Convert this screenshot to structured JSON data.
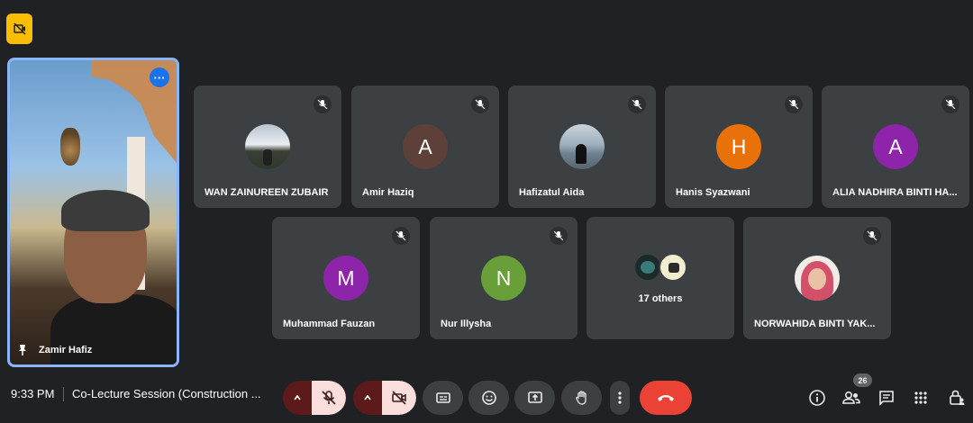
{
  "top_badge": {
    "icon": "no-video-badge-icon",
    "color": "#fbbc04"
  },
  "speaker": {
    "name": "Zamir Hafiz",
    "more_icon": "more-options-icon",
    "pin_icon": "pin-icon"
  },
  "tiles_row1": [
    {
      "name": "WAN ZAINUREEN ZUBAIR",
      "avatar_type": "photo",
      "avatar_letter": "",
      "avatar_color": "#6d7b8a"
    },
    {
      "name": "Amir Haziq",
      "avatar_type": "letter",
      "avatar_letter": "A",
      "avatar_color": "#5d4037"
    },
    {
      "name": "Hafizatul Aida",
      "avatar_type": "photo",
      "avatar_letter": "",
      "avatar_color": "#8fa3b5"
    },
    {
      "name": "Hanis Syazwani",
      "avatar_type": "letter",
      "avatar_letter": "H",
      "avatar_color": "#e8710a"
    },
    {
      "name": "ALIA NADHIRA BINTI HA...",
      "avatar_type": "letter",
      "avatar_letter": "A",
      "avatar_color": "#8e24aa"
    }
  ],
  "tiles_row2": [
    {
      "name": "Muhammad Fauzan",
      "avatar_type": "letter",
      "avatar_letter": "M",
      "avatar_color": "#8e24aa"
    },
    {
      "name": "Nur Illysha",
      "avatar_type": "letter",
      "avatar_letter": "N",
      "avatar_color": "#689f38"
    },
    {
      "name": "",
      "others_label": "17 others"
    },
    {
      "name": "NORWAHIDA BINTI YAK...",
      "avatar_type": "photo",
      "avatar_letter": "",
      "avatar_color": "#e5b8a8"
    }
  ],
  "bottom_bar": {
    "time": "9:33 PM",
    "meeting_title": "Co-Lecture Session (Construction ...",
    "participant_count": "26"
  },
  "colors": {
    "background": "#202124",
    "tile": "#3c4043",
    "active_border": "#8ab4f8",
    "leave": "#ea4335",
    "muted_control": "#f9dedc",
    "muted_arrow": "#5c1a1a"
  }
}
